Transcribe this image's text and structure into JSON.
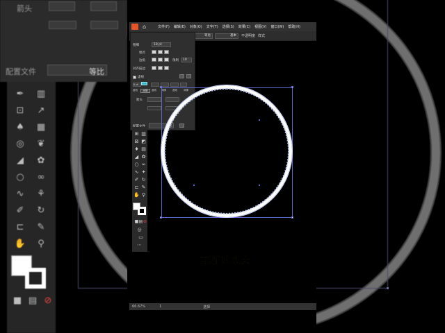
{
  "menu": {
    "items": [
      "文件(F)",
      "编辑(E)",
      "对象(O)",
      "文字(T)",
      "选择(S)",
      "效果(C)",
      "视图(V)",
      "窗口(W)",
      "帮助(H)"
    ]
  },
  "control_bar": {
    "stroke_label": "描边",
    "stroke_value": "18 pt",
    "profile_label": "等比",
    "brush_label": "基本",
    "opacity_label": "不透明度",
    "style_label": "样式"
  },
  "stroke_panel": {
    "weight_label": "粗细",
    "weight_value": "18 pt",
    "cap_label": "端点",
    "corner_label": "边角",
    "limit_label": "限制",
    "limit_value": "10",
    "align_label": "对齐描边",
    "dashed_label": "虚线",
    "dash_value": "0 pt",
    "gap_value": "0 pt",
    "tooltip": "间隙",
    "dash_headers": [
      "虚线",
      "间隙",
      "虚线",
      "间隙",
      "虚线",
      "间隙"
    ],
    "arrow_label": "箭头",
    "profile_label": "配置文件",
    "profile_value": "等比"
  },
  "background_panel": {
    "arrow_label": "箭头",
    "profile_label": "配置文件",
    "profile_value": "等比"
  },
  "status": {
    "zoom": "66.67%",
    "page": "1",
    "mode": "选择"
  },
  "caption": "再把间隙调大"
}
